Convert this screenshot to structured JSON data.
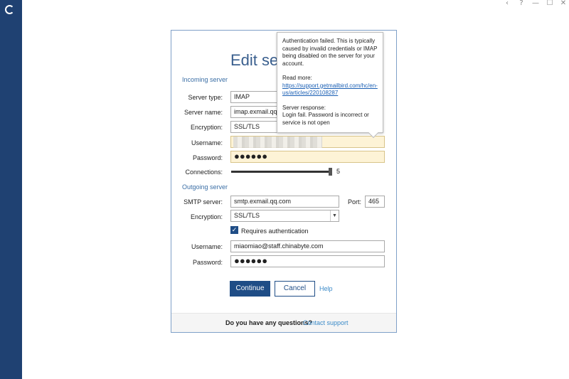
{
  "window_controls": [
    "‹",
    "?",
    "—",
    "☐",
    "✕"
  ],
  "dialog": {
    "title": "Edit sett",
    "incoming_section": "Incoming server",
    "incoming": {
      "server_type_label": "Server type:",
      "server_type_value": "IMAP",
      "server_name_label": "Server name:",
      "server_name_value": "imap.exmail.qq.co",
      "encryption_label": "Encryption:",
      "encryption_value": "SSL/TLS",
      "username_label": "Username:",
      "username_value": "",
      "password_label": "Password:",
      "password_value": "●●●●●●",
      "connections_label": "Connections:",
      "connections_value": "5"
    },
    "outgoing_section": "Outgoing server",
    "outgoing": {
      "smtp_label": "SMTP server:",
      "smtp_value": "smtp.exmail.qq.com",
      "port_label": "Port:",
      "port_value": "465",
      "encryption_label": "Encryption:",
      "encryption_value": "SSL/TLS",
      "requires_auth_label": "Requires authentication",
      "username_label": "Username:",
      "username_value": "miaomiao@staff.chinabyte.com",
      "password_label": "Password:",
      "password_value": "●●●●●●"
    },
    "continue_label": "Continue",
    "cancel_label": "Cancel",
    "help_label": "Help",
    "footer_question": "Do you have any questions?",
    "footer_link": "Contact support"
  },
  "tooltip": {
    "message": "Authentication failed. This is typically caused by invalid credentials or IMAP being disabled on the server for your account.",
    "read_more_label": "Read more:",
    "read_more_link": "https://support.getmailbird.com/hc/en-us/articles/220108287",
    "server_response_label": "Server response:",
    "server_response": "Login fail. Password is incorrect or service is not open"
  },
  "colors": {
    "sidebar": "#1f4172",
    "primary": "#1f4d86",
    "error_field": "#fdf3d6",
    "link": "#3a8ac8"
  }
}
